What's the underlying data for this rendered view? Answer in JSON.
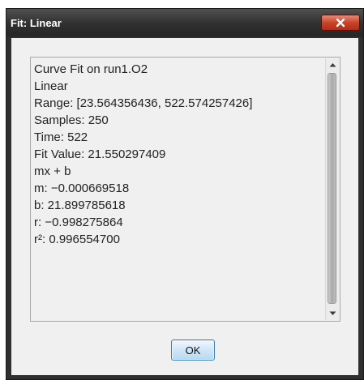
{
  "window": {
    "title": "Fit: Linear",
    "close_icon": "close-icon"
  },
  "results": {
    "lines": [
      "Curve Fit on run1.O2",
      "Linear",
      "Range: [23.564356436, 522.574257426]",
      "Samples: 250",
      "Time: 522",
      "Fit Value: 21.550297409",
      "mx + b",
      "m: −0.000669518",
      "b: 21.899785618",
      "r: −0.998275864",
      "r²: 0.996554700"
    ]
  },
  "scrollbar": {
    "up_icon": "scroll-up-arrow-icon",
    "down_icon": "scroll-down-arrow-icon"
  },
  "buttons": {
    "ok_label": "OK"
  },
  "colors": {
    "title_bar": "#303030",
    "close_button": "#c9432a",
    "dialog_bg": "#f0f0f0",
    "ok_border": "#3c7fb1"
  }
}
